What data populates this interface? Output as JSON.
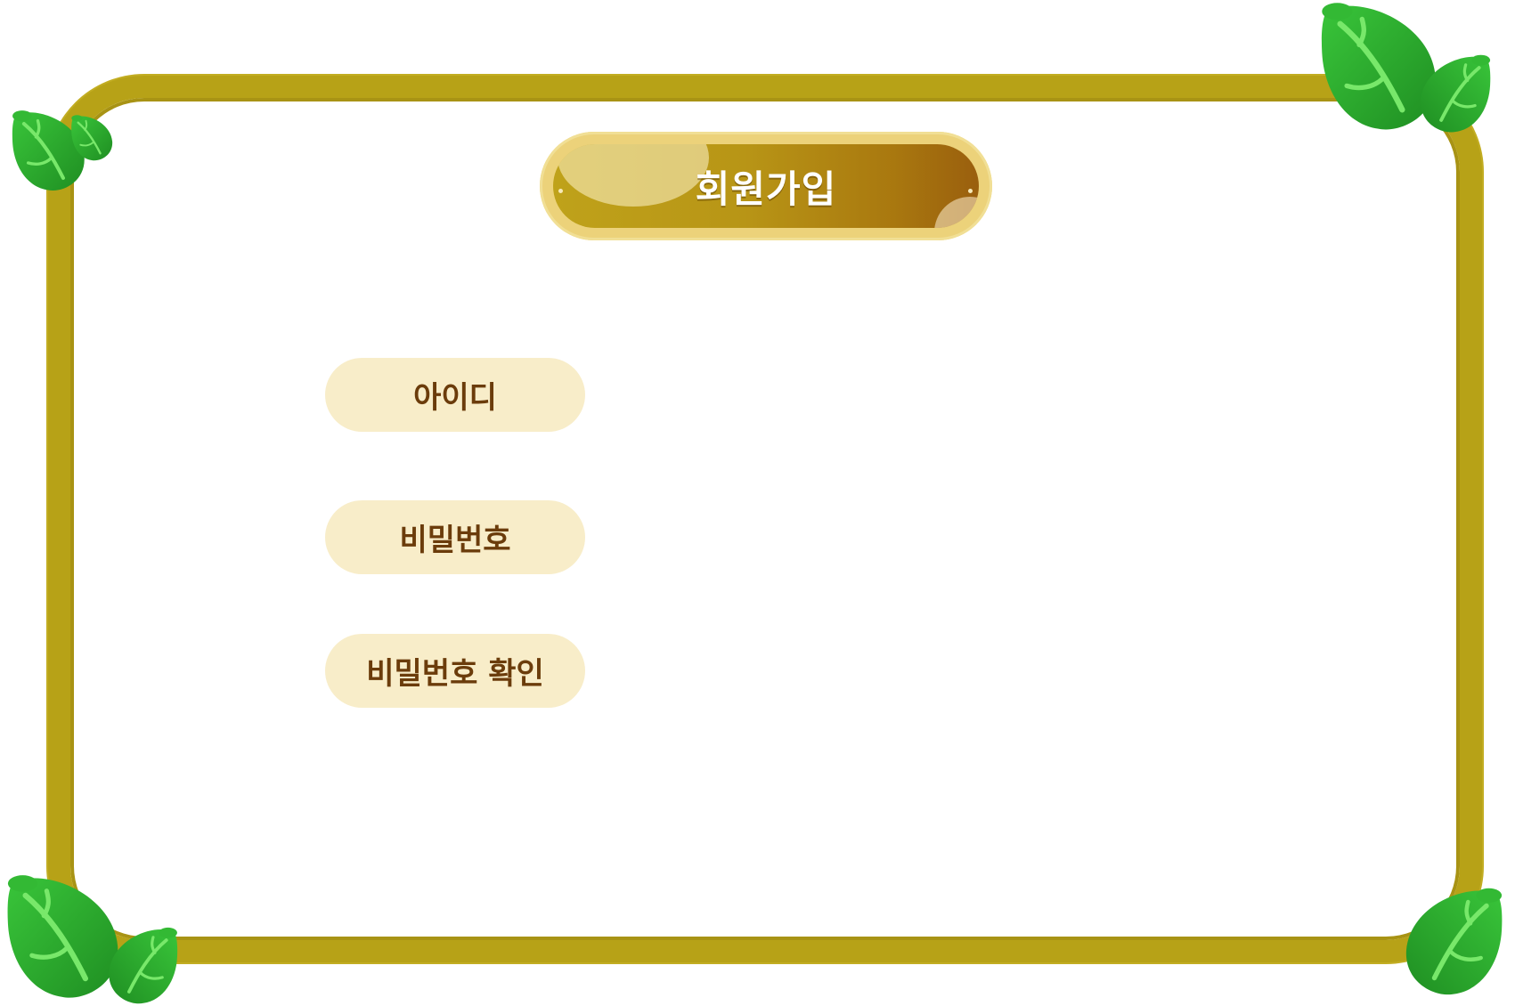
{
  "title": "회원가입",
  "fields": [
    {
      "label": "아이디"
    },
    {
      "label": "비밀번호"
    },
    {
      "label": "비밀번호 확인"
    }
  ],
  "colors": {
    "frame": "#b7a217",
    "title_gradient_start": "#bfa21a",
    "title_gradient_end": "#9a5f0e",
    "label_background": "#f8edc9",
    "label_text": "#6b3c0b",
    "leaf": "#2aa82a"
  },
  "decorations": [
    "leaf-icon"
  ]
}
